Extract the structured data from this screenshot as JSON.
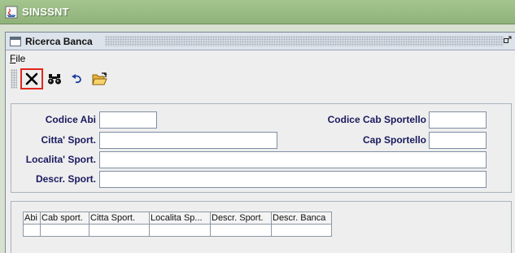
{
  "app": {
    "title": "SINSSNT"
  },
  "frame": {
    "title": "Ricerca Banca",
    "restore_glyph": "▫ʹ"
  },
  "menu": {
    "file_mnemonic": "F",
    "file_rest": "ile"
  },
  "toolbar": {
    "buttons": [
      {
        "icon": "close-x-icon"
      },
      {
        "icon": "binoculars-search-icon"
      },
      {
        "icon": "undo-arrow-icon"
      },
      {
        "icon": "open-folder-icon"
      }
    ]
  },
  "form": {
    "codice_abi_label": "Codice Abi",
    "codice_abi_value": "",
    "codice_cab_label": "Codice Cab Sportello",
    "codice_cab_value": "",
    "citta_label": "Citta' Sport.",
    "citta_value": "",
    "cap_label": "Cap Sportello",
    "cap_value": "",
    "localita_label": "Localita' Sport.",
    "localita_value": "",
    "descr_label": "Descr. Sport.",
    "descr_value": ""
  },
  "table": {
    "columns": [
      "Abi",
      "Cab sport.",
      "Citta Sport.",
      "Localita Sp...",
      "Descr. Sport.",
      "Descr. Banca"
    ],
    "rows": [
      [
        "",
        "",
        "",
        "",
        "",
        ""
      ]
    ]
  },
  "colors": {
    "titlebar": "#a5c58f",
    "active_button_border": "#e0281e",
    "label_text": "#1a1a60"
  }
}
